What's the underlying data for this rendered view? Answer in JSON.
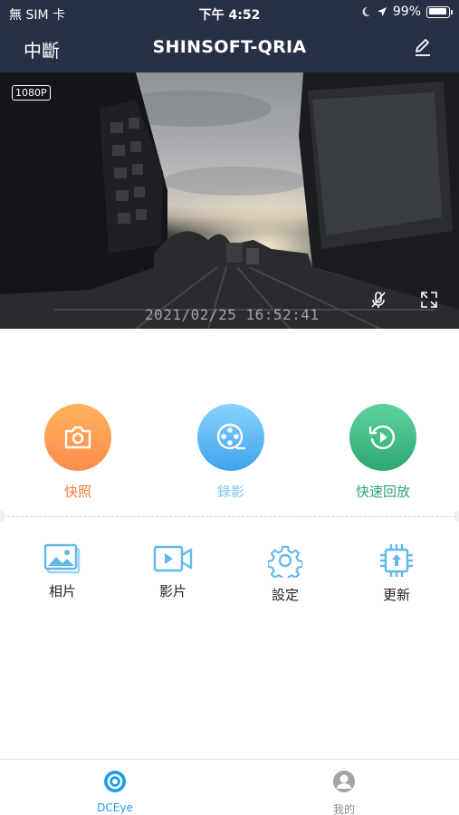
{
  "status_bar": {
    "carrier": "無 SIM 卡",
    "time": "下午 4:52",
    "battery": "99%"
  },
  "nav": {
    "left_action": "中斷",
    "title": "SHINSOFT-QRIA",
    "edit_icon": "pencil-icon"
  },
  "video": {
    "resolution": "1080P",
    "timestamp": "2021/02/25  16:52:41"
  },
  "actions": [
    {
      "label": "快照",
      "icon": "camera-icon",
      "color": "#f3793a"
    },
    {
      "label": "錄影",
      "icon": "film-reel-icon",
      "color": "#7cc7f5"
    },
    {
      "label": "快速回放",
      "icon": "replay-icon",
      "color": "#2ea774"
    }
  ],
  "grid": [
    {
      "label": "相片",
      "icon": "photos-icon"
    },
    {
      "label": "影片",
      "icon": "video-icon"
    },
    {
      "label": "設定",
      "icon": "gear-icon"
    },
    {
      "label": "更新",
      "icon": "chip-update-icon"
    }
  ],
  "tabs": [
    {
      "label": "DCEye",
      "icon": "dceye-icon",
      "active": true
    },
    {
      "label": "我的",
      "icon": "profile-icon",
      "active": false
    }
  ],
  "colors": {
    "header_bg": "#283046",
    "accent": "#1e9ee9",
    "icon_blue": "#62b8ec"
  }
}
